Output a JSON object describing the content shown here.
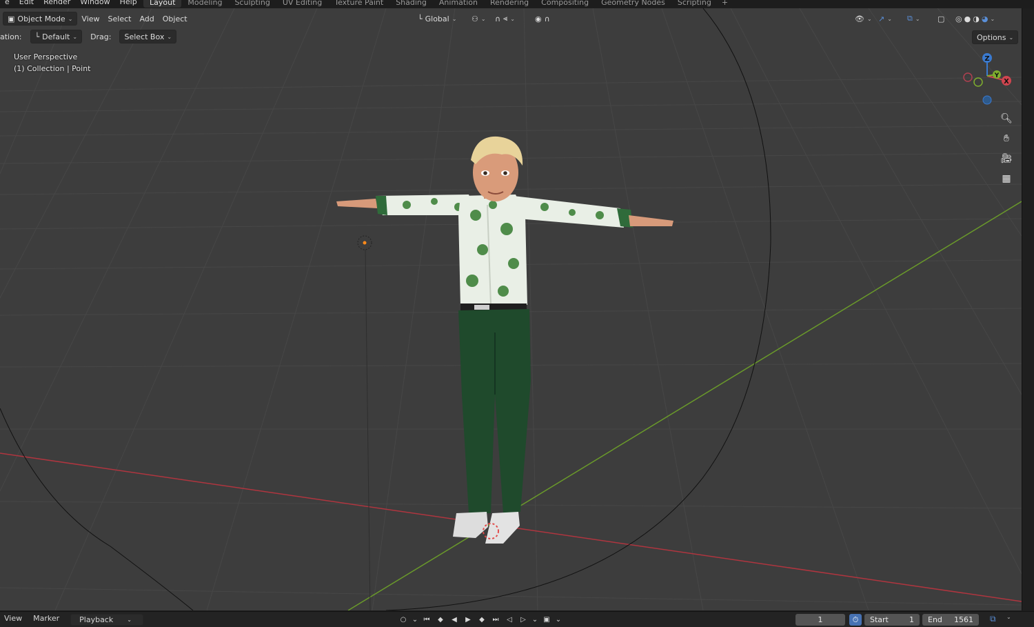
{
  "top_menu": [
    "e",
    "Edit",
    "Render",
    "Window",
    "Help"
  ],
  "workspaces": {
    "tabs": [
      "Layout",
      "Modeling",
      "Sculpting",
      "UV Editing",
      "Texture Paint",
      "Shading",
      "Animation",
      "Rendering",
      "Compositing",
      "Geometry Nodes",
      "Scripting"
    ],
    "active": "Layout",
    "add_label": "+"
  },
  "header": {
    "mode": "Object Mode",
    "menus": [
      "View",
      "Select",
      "Add",
      "Object"
    ],
    "transform_orientation": "Global"
  },
  "tool_settings": {
    "orientation_label": "ation:",
    "orientation_value": "Default",
    "drag_label": "Drag:",
    "drag_value": "Select Box",
    "options_label": "Options"
  },
  "viewport_info": {
    "line1": "User Perspective",
    "line2": "(1) Collection | Point"
  },
  "gizmo": {
    "z": "Z",
    "y": "Y",
    "x": "X"
  },
  "timeline": {
    "menus": [
      "View",
      "Marker",
      "Playback"
    ],
    "current_frame": "1",
    "start_label": "Start",
    "start_value": "1",
    "end_label": "End",
    "end_value": "1561"
  },
  "colors": {
    "viewport_bg": "#3d3d3d",
    "grid_line": "#4a4a4a",
    "x_axis": "#b0353f",
    "y_axis": "#6a9a2a",
    "active_tab": "#303030",
    "accent_blue": "#4772b3"
  }
}
